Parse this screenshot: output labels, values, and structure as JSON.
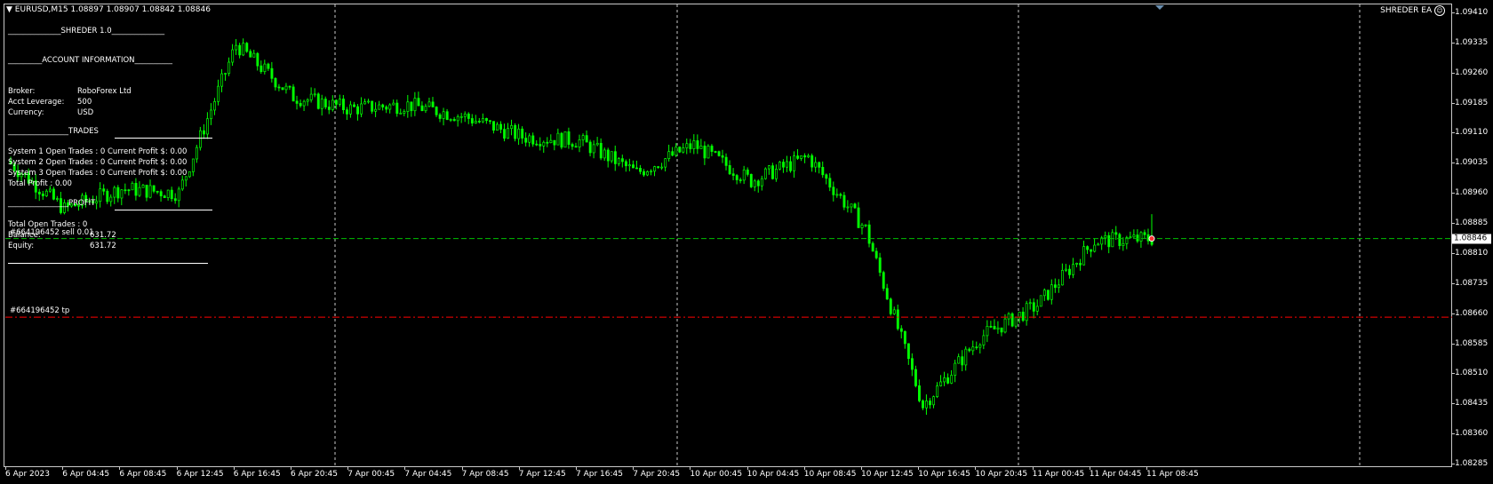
{
  "header": {
    "symbol_text": "EURUSD,M15  1.08897 1.08907 1.08842 1.08846",
    "ea_name": "SHREDER EA"
  },
  "panel": {
    "title": "______________SHREDER 1.0______________",
    "account_header": "_________ACCOUNT INFORMATION__________",
    "broker_label": "Broker:",
    "broker_value": "RoboForex Ltd",
    "leverage_label": "Acct Leverage:",
    "leverage_value": "500",
    "currency_label": "Currency:",
    "currency_value": "USD",
    "trades_header": "________________TRADES",
    "sys1": "System 1 Open Trades :  0   Current Profit $:  0.00",
    "sys2": "System 2 Open Trades :  0   Current Profit $:  0.00",
    "sys3": "System 3 Open Trades :  0   Current Profit $:  0.00",
    "total_profit": "Total Profit         :  0.00",
    "profit_header": "________________PROFIT",
    "total_open_trades": "Total Open Trades :   0",
    "balance_label": "Balance:",
    "balance_value": "631.72",
    "equity_label": "Equity:",
    "equity_value": "631.72"
  },
  "orders": {
    "sell_label": "#664196452 sell 0.01",
    "tp_label": "#664196452 tp"
  },
  "price_axis": {
    "labels": [
      "1.09410",
      "1.09335",
      "1.09260",
      "1.09185",
      "1.09110",
      "1.09035",
      "1.08960",
      "1.08885",
      "1.08810",
      "1.08735",
      "1.08660",
      "1.08585",
      "1.08510",
      "1.08435",
      "1.08360",
      "1.08285"
    ],
    "current_price": "1.08846"
  },
  "time_axis": {
    "labels": [
      "6 Apr 2023",
      "6 Apr 04:45",
      "6 Apr 08:45",
      "6 Apr 12:45",
      "6 Apr 16:45",
      "6 Apr 20:45",
      "7 Apr 00:45",
      "7 Apr 04:45",
      "7 Apr 08:45",
      "7 Apr 12:45",
      "7 Apr 16:45",
      "7 Apr 20:45",
      "10 Apr 00:45",
      "10 Apr 04:45",
      "10 Apr 08:45",
      "10 Apr 12:45",
      "10 Apr 16:45",
      "10 Apr 20:45",
      "11 Apr 00:45",
      "11 Apr 04:45",
      "11 Apr 08:45"
    ]
  },
  "colors": {
    "background": "#000000",
    "candle": "#00ff00",
    "bid_line": "#00c000",
    "tp_line": "#ff0000",
    "grid": "#c8c8c8",
    "text": "#ffffff"
  },
  "chart_data": {
    "type": "candlestick",
    "symbol": "EURUSD",
    "timeframe": "M15",
    "ylim": [
      1.08285,
      1.0941
    ],
    "last_ohlc": {
      "open": 1.08897,
      "high": 1.08907,
      "low": 1.08842,
      "close": 1.08846
    },
    "current_price": 1.08846,
    "tp_level": 1.0865,
    "approx_close_path": [
      {
        "t": "6 Apr 00:00",
        "p": 1.0904
      },
      {
        "t": "6 Apr 04:45",
        "p": 1.0892
      },
      {
        "t": "6 Apr 08:45",
        "p": 1.0897
      },
      {
        "t": "6 Apr 12:45",
        "p": 1.0896
      },
      {
        "t": "6 Apr 16:45",
        "p": 1.0933
      },
      {
        "t": "6 Apr 20:45",
        "p": 1.092
      },
      {
        "t": "7 Apr 00:45",
        "p": 1.0917
      },
      {
        "t": "7 Apr 04:45",
        "p": 1.0918
      },
      {
        "t": "7 Apr 08:45",
        "p": 1.0915
      },
      {
        "t": "7 Apr 12:45",
        "p": 1.091
      },
      {
        "t": "7 Apr 16:45",
        "p": 1.0909
      },
      {
        "t": "7 Apr 20:45",
        "p": 1.0901
      },
      {
        "t": "10 Apr 00:45",
        "p": 1.0908
      },
      {
        "t": "10 Apr 04:45",
        "p": 1.0899
      },
      {
        "t": "10 Apr 08:45",
        "p": 1.0905
      },
      {
        "t": "10 Apr 12:45",
        "p": 1.0887
      },
      {
        "t": "10 Apr 16:45",
        "p": 1.0843
      },
      {
        "t": "10 Apr 20:45",
        "p": 1.086
      },
      {
        "t": "11 Apr 00:45",
        "p": 1.0868
      },
      {
        "t": "11 Apr 04:45",
        "p": 1.0884
      },
      {
        "t": "11 Apr 08:45",
        "p": 1.08846
      }
    ]
  }
}
